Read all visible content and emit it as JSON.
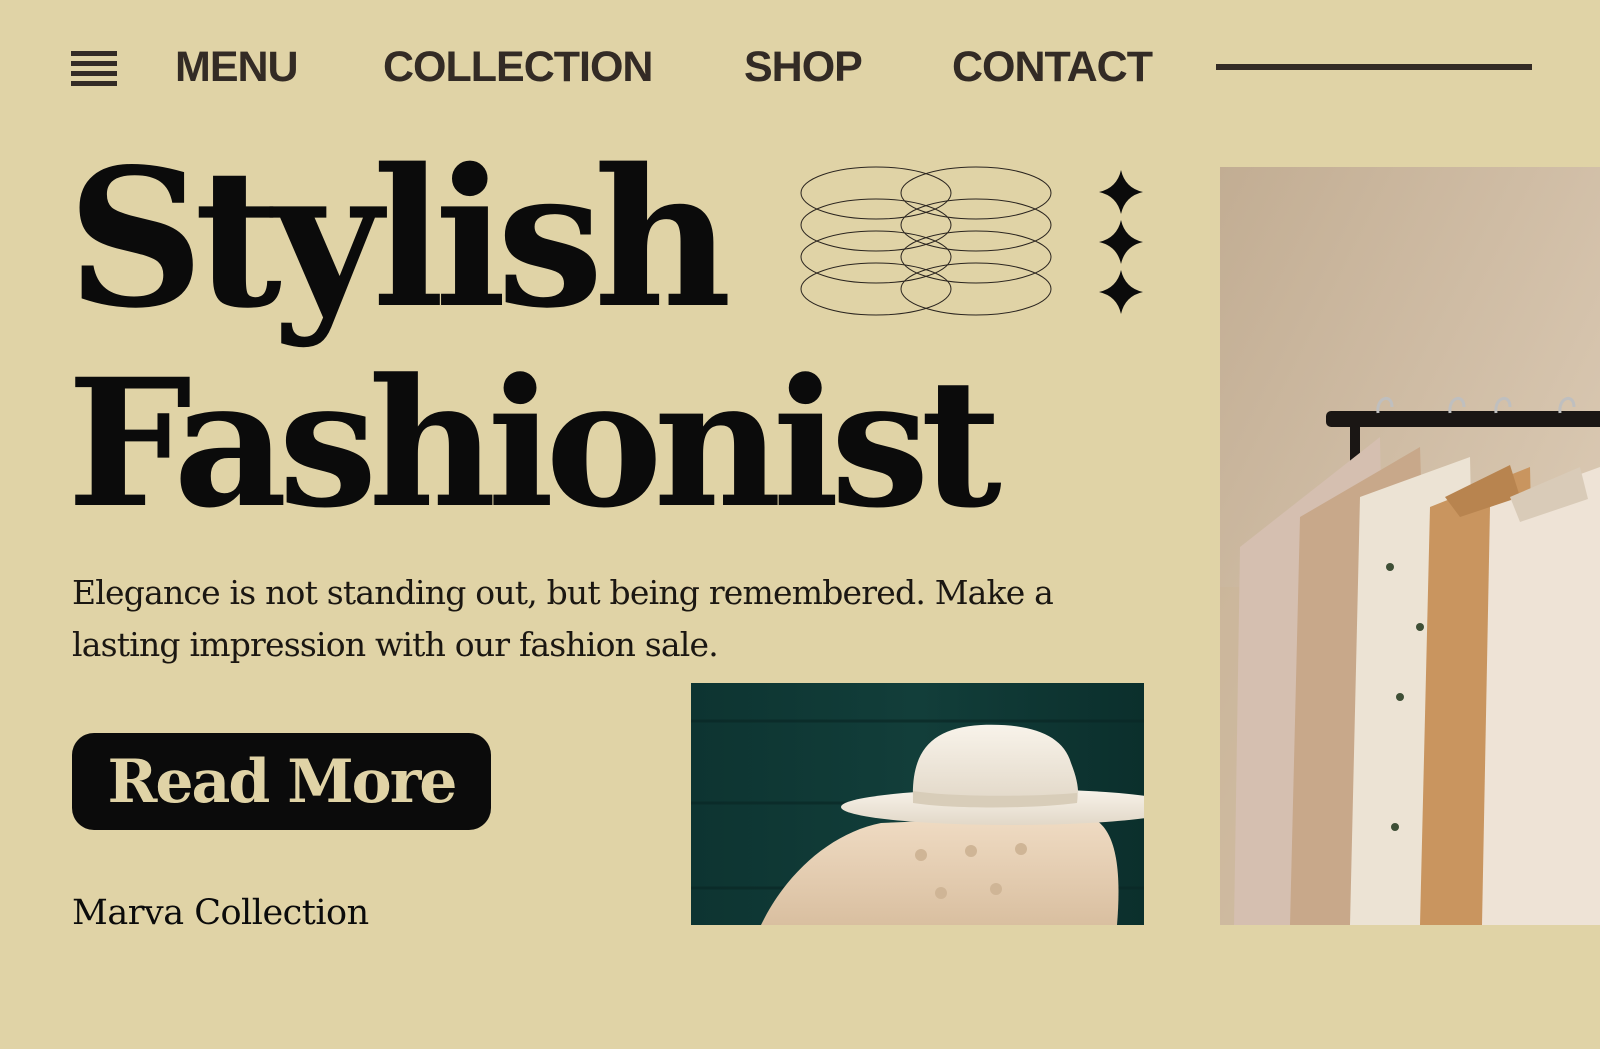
{
  "nav": {
    "menu_icon": "hamburger-menu-icon",
    "links": [
      "MENU",
      "COLLECTION",
      "SHOP",
      "CONTACT"
    ]
  },
  "hero": {
    "headline_line1": "Stylish",
    "headline_line2": "Fashionist",
    "tagline": "Elegance is not standing out, but being remembered. Make a lasting impression with our fashion sale.",
    "cta_label": "Read More",
    "brand": "Marva Collection"
  },
  "colors": {
    "background": "#E0D3A6",
    "text": "#0B0B0B",
    "nav_text": "#332B25",
    "button_bg": "#0B0B0B",
    "button_text": "#E0D3A6"
  }
}
